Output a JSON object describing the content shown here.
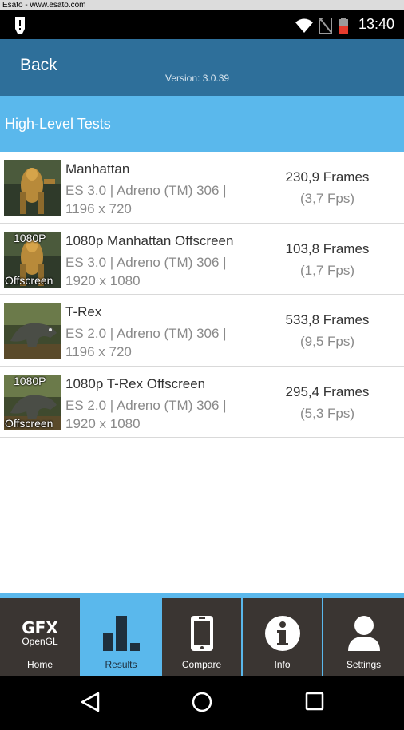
{
  "watermark": "Esato - www.esato.com",
  "status": {
    "time": "13:40"
  },
  "header": {
    "back_label": "Back",
    "version": "Version: 3.0.39"
  },
  "section": {
    "title": "High-Level Tests"
  },
  "tests": [
    {
      "name": "Manhattan",
      "desc_line1": "ES 3.0 | Adreno (TM) 306 |",
      "desc_line2": "1196 x 720",
      "frames": "230,9 Frames",
      "fps": "(3,7 Fps)",
      "badge_top": "",
      "badge_bottom": ""
    },
    {
      "name": "1080p Manhattan Offscreen",
      "desc_line1": "ES 3.0 | Adreno (TM) 306 |",
      "desc_line2": "1920 x 1080",
      "frames": "103,8 Frames",
      "fps": "(1,7 Fps)",
      "badge_top": "1080P",
      "badge_bottom": "Offscreen"
    },
    {
      "name": "T-Rex",
      "desc_line1": "ES 2.0 | Adreno (TM) 306 |",
      "desc_line2": "1196 x 720",
      "frames": "533,8 Frames",
      "fps": "(9,5 Fps)",
      "badge_top": "",
      "badge_bottom": ""
    },
    {
      "name": "1080p T-Rex Offscreen",
      "desc_line1": "ES 2.0 | Adreno (TM) 306 |",
      "desc_line2": "1920 x 1080",
      "frames": "295,4 Frames",
      "fps": "(5,3 Fps)",
      "badge_top": "1080P",
      "badge_bottom": "Offscreen"
    }
  ],
  "tabs": [
    {
      "label": "Home",
      "icon": "gfx-logo-icon",
      "logo_line1": "GFX",
      "logo_line2": "OpenGL",
      "active": false
    },
    {
      "label": "Results",
      "icon": "bar-chart-icon",
      "active": true
    },
    {
      "label": "Compare",
      "icon": "phone-icon",
      "active": false
    },
    {
      "label": "Info",
      "icon": "info-icon",
      "active": false
    },
    {
      "label": "Settings",
      "icon": "user-icon",
      "active": false
    }
  ],
  "colors": {
    "header": "#2e6f9a",
    "section": "#5ab8ec",
    "tab_bg": "#3a3532",
    "tab_active": "#5ab8ec"
  }
}
